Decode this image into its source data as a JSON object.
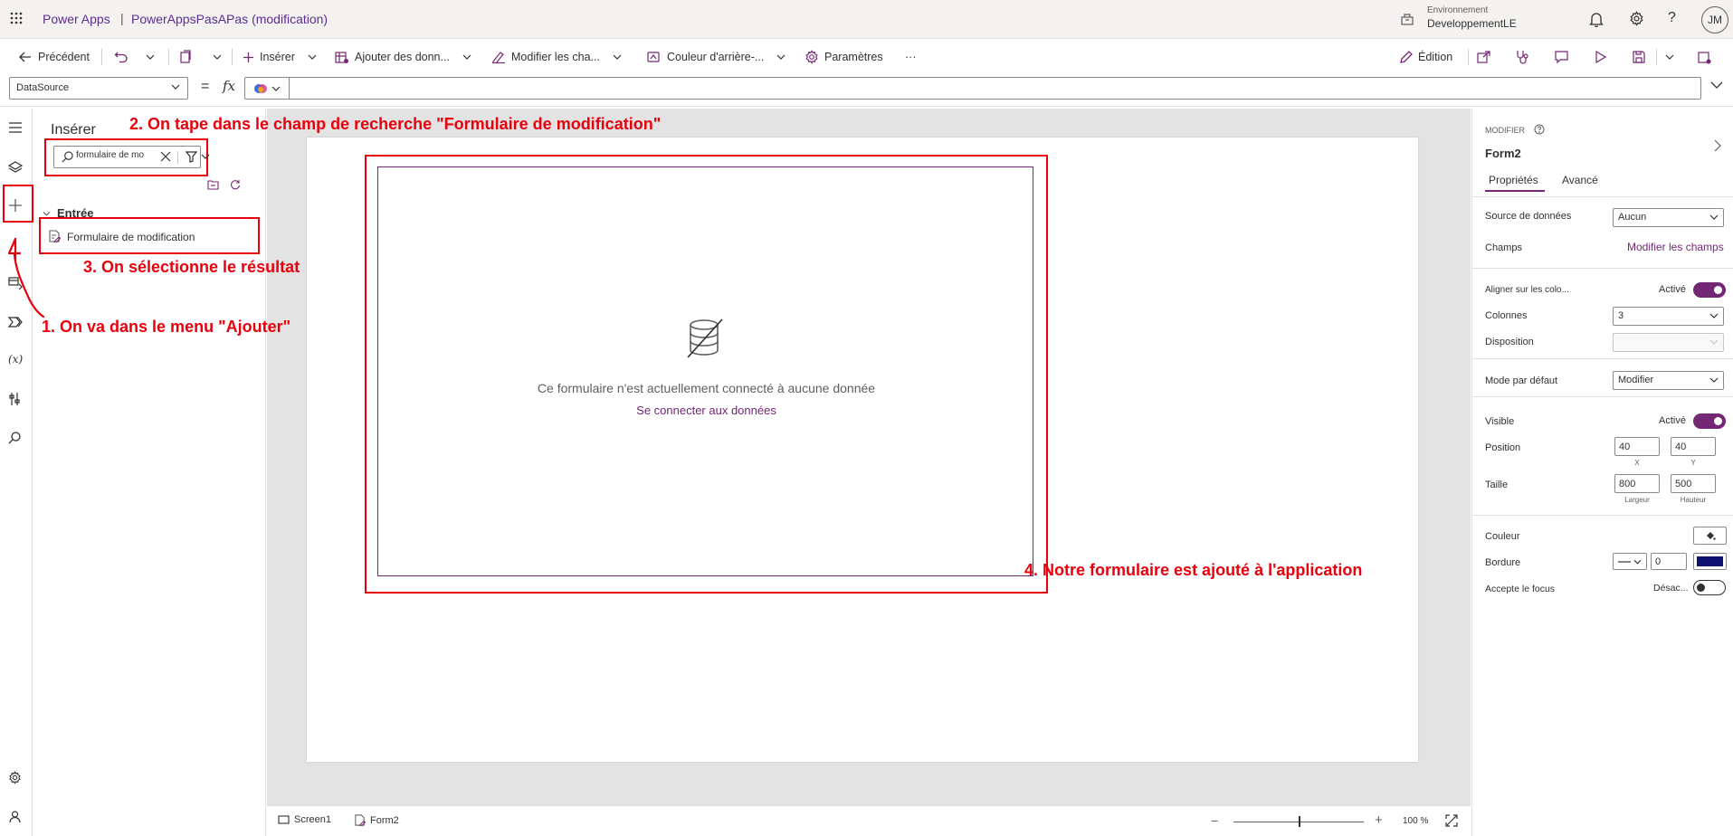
{
  "titlebar": {
    "brand": "Power Apps",
    "separator": "|",
    "app_name": "PowerAppsPasAPas (modification)",
    "env_label": "Environnement",
    "env_value": "DeveloppementLE",
    "avatar_initials": "JM"
  },
  "command_bar": {
    "back": "Précédent",
    "insert": "Insérer",
    "add_data": "Ajouter des donn...",
    "edit_fields": "Modifier les cha...",
    "background_color": "Couleur d'arrière-...",
    "settings": "Paramètres",
    "more": "···",
    "edit_mode": "Édition"
  },
  "formula_bar": {
    "property": "DataSource",
    "equals": "=",
    "fx": "fx",
    "formula": ""
  },
  "insert_panel": {
    "title": "Insérer",
    "search_value": "formulaire de mo",
    "category": "Entrée",
    "result_label": "Formulaire de modification"
  },
  "canvas": {
    "form_empty_message": "Ce formulaire n'est actuellement connecté à aucune donnée",
    "form_connect_link": "Se connecter aux données"
  },
  "annotations": {
    "step1": "1. On va dans le menu \"Ajouter\"",
    "step2": "2. On tape dans le champ de recherche \"Formulaire de modification\"",
    "step3": "3. On sélectionne le résultat",
    "step4": "4. Notre formulaire est ajouté à l'application"
  },
  "status_bar": {
    "screen_tab": "Screen1",
    "form_tab": "Form2",
    "zoom_minus": "−",
    "zoom_plus": "+",
    "zoom_value": "100 %",
    "zoom_fraction": 0.5
  },
  "properties": {
    "section": "MODIFIER",
    "control_name": "Form2",
    "tab_properties": "Propriétés",
    "tab_advanced": "Avancé",
    "datasource_label": "Source de données",
    "datasource_value": "Aucun",
    "fields_label": "Champs",
    "fields_link": "Modifier les champs",
    "snap_label": "Aligner sur les colo...",
    "snap_state": "Activé",
    "columns_label": "Colonnes",
    "columns_value": "3",
    "layout_label": "Disposition",
    "layout_value": "",
    "mode_label": "Mode par défaut",
    "mode_value": "Modifier",
    "visible_label": "Visible",
    "visible_state": "Activé",
    "position_label": "Position",
    "position_x": "40",
    "position_y": "40",
    "x_label": "X",
    "y_label": "Y",
    "size_label": "Taille",
    "width": "800",
    "height": "500",
    "width_label": "Largeur",
    "height_label": "Hauteur",
    "color_label": "Couleur",
    "border_label": "Bordure",
    "border_width": "0",
    "border_color": "#0f1171",
    "focus_label": "Accepte le focus",
    "focus_state": "Désac..."
  },
  "colors": {
    "accent": "#742774",
    "brand": "#5c2d91",
    "annotation": "#e8000d"
  }
}
